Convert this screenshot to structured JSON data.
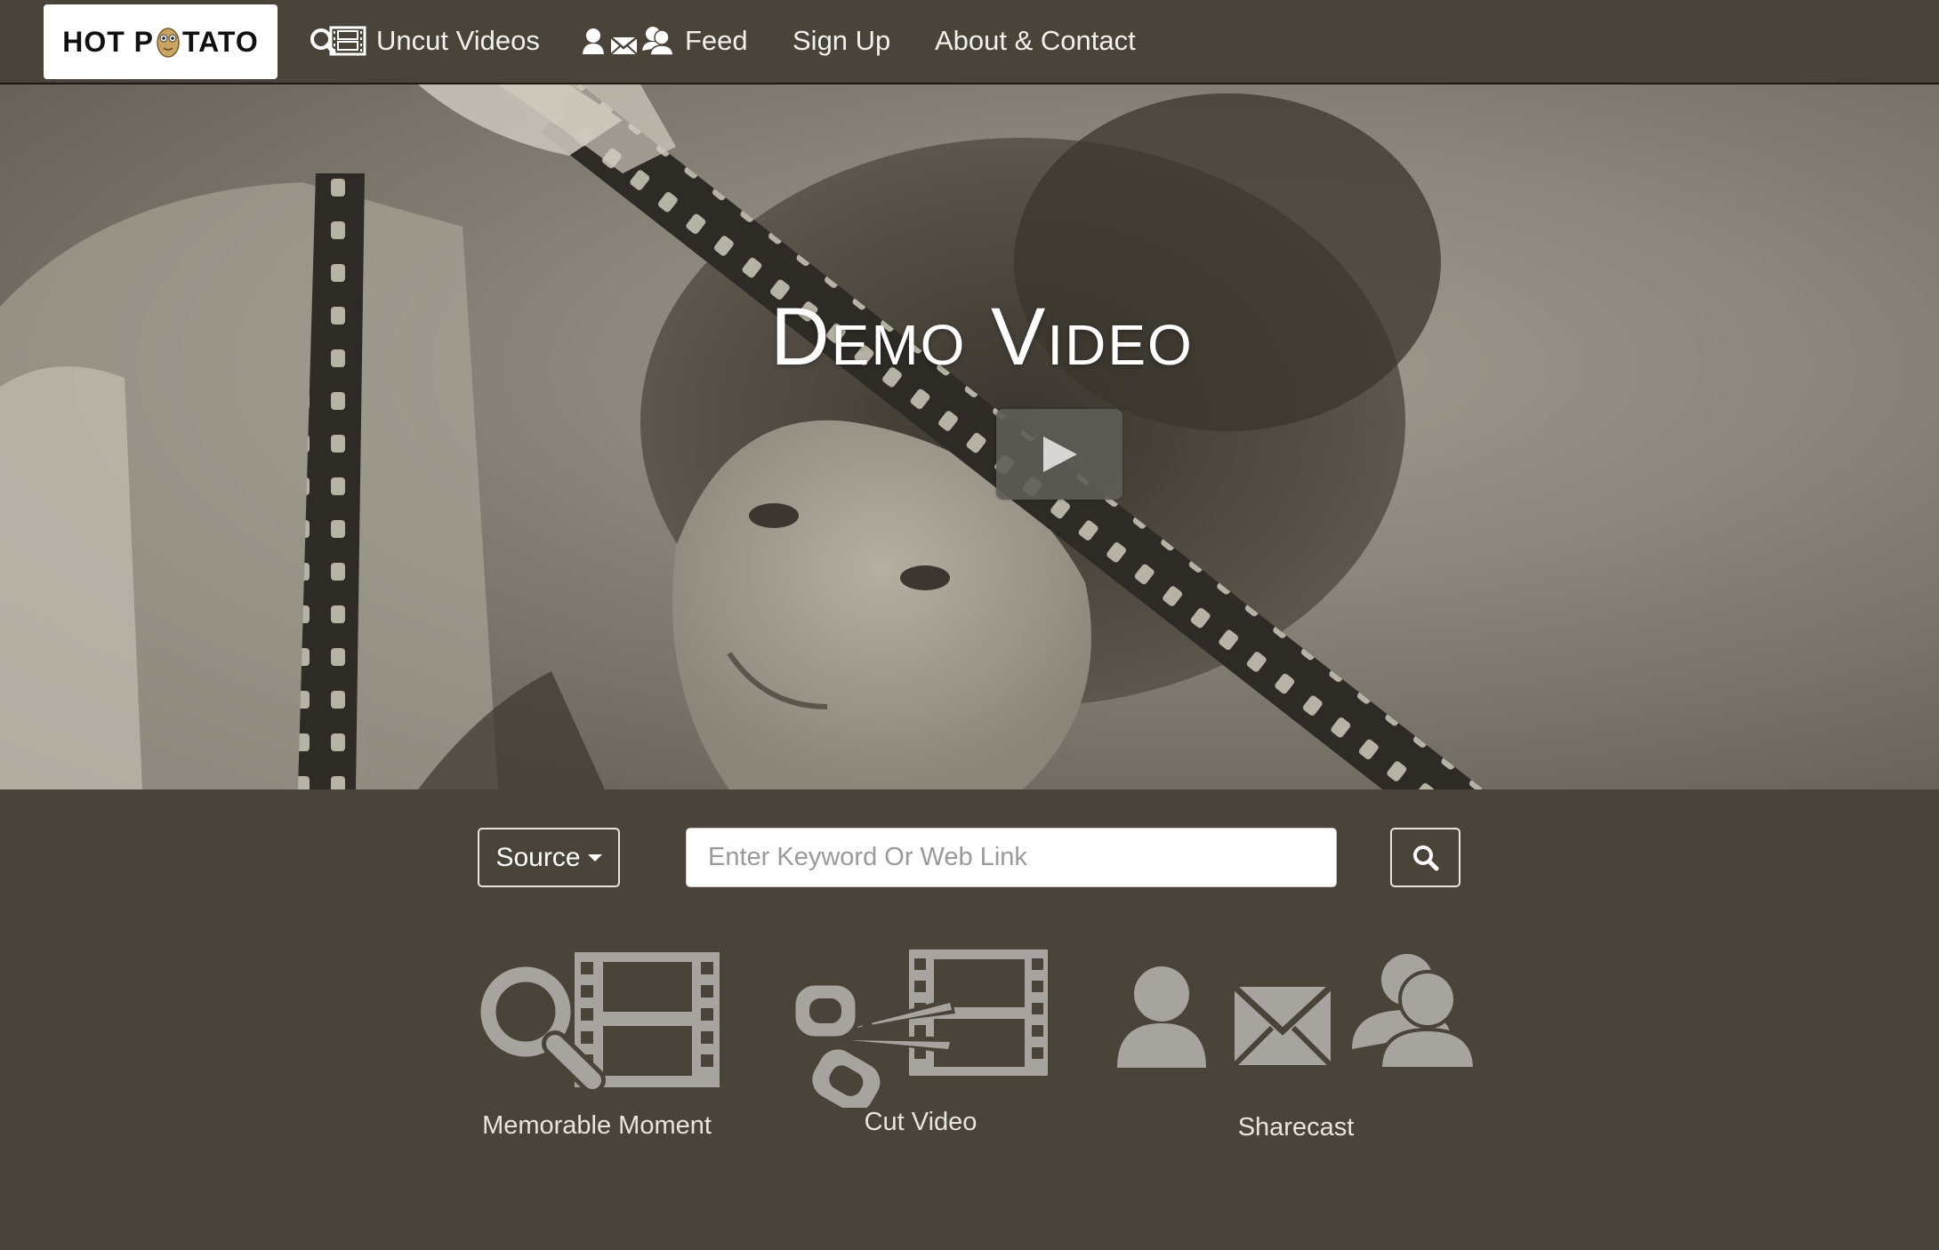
{
  "brand": {
    "left": "HOT P",
    "right": "TATO"
  },
  "nav": [
    {
      "label": "Uncut Videos",
      "icon": "search-film-icon"
    },
    {
      "label": "Feed",
      "icon": "sharecast-icon"
    },
    {
      "label": "Sign Up"
    },
    {
      "label": "About & Contact"
    }
  ],
  "hero": {
    "title": "Demo Video",
    "play_icon": "play-icon"
  },
  "search": {
    "source_label": "Source",
    "placeholder": "Enter Keyword Or Web Link",
    "value": "",
    "button_icon": "search-icon"
  },
  "features": [
    {
      "label": "Memorable Moment",
      "icon": "search-film-icon"
    },
    {
      "label": "Cut Video",
      "icon": "scissors-film-icon"
    },
    {
      "label": "Sharecast",
      "icon": "user-mail-users-icon"
    }
  ],
  "colors": {
    "background": "#4a433a",
    "icon_gray": "#a7a49f",
    "text": "#f2f0ec"
  }
}
